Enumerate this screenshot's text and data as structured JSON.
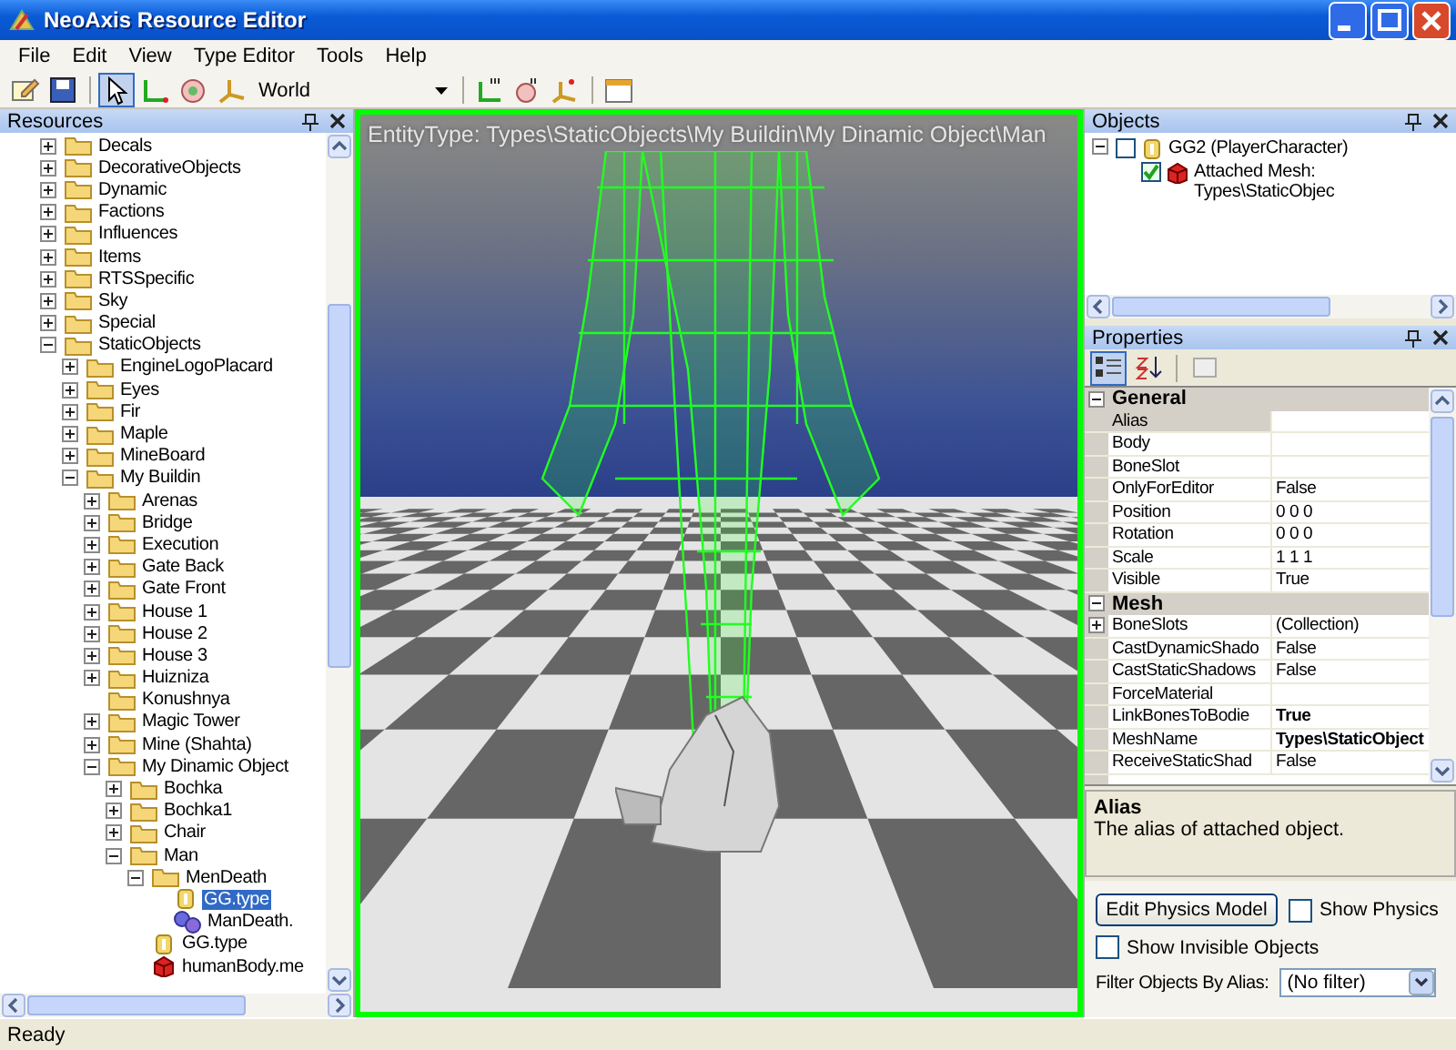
{
  "window": {
    "title": "NeoAxis Resource Editor"
  },
  "menu": [
    "File",
    "Edit",
    "View",
    "Type Editor",
    "Tools",
    "Help"
  ],
  "toolbar": {
    "groups": [
      [
        {
          "kind": "new",
          "selected": false
        },
        {
          "kind": "save",
          "selected": false
        }
      ],
      [
        {
          "kind": "select",
          "selected": true
        },
        {
          "kind": "move",
          "selected": false
        },
        {
          "kind": "rotate",
          "selected": false
        },
        {
          "kind": "scale",
          "selected": false
        }
      ]
    ],
    "space": "World",
    "groups_after": [
      [
        {
          "kind": "snap-move",
          "selected": false
        },
        {
          "kind": "snap-rotate",
          "selected": false
        },
        {
          "kind": "snap-scale",
          "selected": false
        }
      ],
      [
        {
          "kind": "window",
          "selected": false
        }
      ]
    ]
  },
  "resources": {
    "title": "Resources",
    "tree": [
      {
        "label": "Decals",
        "kind": "folder",
        "expanded": false,
        "selected": false
      },
      {
        "label": "DecorativeObjects",
        "kind": "folder",
        "expanded": false,
        "selected": false
      },
      {
        "label": "Dynamic",
        "kind": "folder",
        "expanded": false,
        "selected": false
      },
      {
        "label": "Factions",
        "kind": "folder",
        "expanded": false,
        "selected": false
      },
      {
        "label": "Influences",
        "kind": "folder",
        "expanded": false,
        "selected": false
      },
      {
        "label": "Items",
        "kind": "folder",
        "expanded": false,
        "selected": false
      },
      {
        "label": "RTSSpecific",
        "kind": "folder",
        "expanded": false,
        "selected": false
      },
      {
        "label": "Sky",
        "kind": "folder",
        "expanded": false,
        "selected": false
      },
      {
        "label": "Special",
        "kind": "folder",
        "expanded": false,
        "selected": false
      },
      {
        "label": "StaticObjects",
        "kind": "folder",
        "expanded": true,
        "selected": false,
        "children": [
          {
            "label": "EngineLogoPlacard",
            "kind": "folder",
            "expanded": false,
            "selected": false
          },
          {
            "label": "Eyes",
            "kind": "folder",
            "expanded": false,
            "selected": false
          },
          {
            "label": "Fir",
            "kind": "folder",
            "expanded": false,
            "selected": false
          },
          {
            "label": "Maple",
            "kind": "folder",
            "expanded": false,
            "selected": false
          },
          {
            "label": "MineBoard",
            "kind": "folder",
            "expanded": false,
            "selected": false
          },
          {
            "label": "My Buildin",
            "kind": "folder",
            "expanded": true,
            "selected": false,
            "children": [
              {
                "label": "Arenas",
                "kind": "folder",
                "expanded": false,
                "selected": false
              },
              {
                "label": "Bridge",
                "kind": "folder",
                "expanded": false,
                "selected": false
              },
              {
                "label": "Execution",
                "kind": "folder",
                "expanded": false,
                "selected": false
              },
              {
                "label": "Gate Back",
                "kind": "folder",
                "expanded": false,
                "selected": false
              },
              {
                "label": "Gate Front",
                "kind": "folder",
                "expanded": false,
                "selected": false
              },
              {
                "label": "House 1",
                "kind": "folder",
                "expanded": false,
                "selected": false
              },
              {
                "label": "House 2",
                "kind": "folder",
                "expanded": false,
                "selected": false
              },
              {
                "label": "House 3",
                "kind": "folder",
                "expanded": false,
                "selected": false
              },
              {
                "label": "Huizniza",
                "kind": "folder",
                "expanded": false,
                "selected": false
              },
              {
                "label": "Konushnya",
                "kind": "folder",
                "selected": false
              },
              {
                "label": "Magic Tower",
                "kind": "folder",
                "expanded": false,
                "selected": false
              },
              {
                "label": "Mine (Shahta)",
                "kind": "folder",
                "expanded": false,
                "selected": false
              },
              {
                "label": "My Dinamic Object",
                "kind": "folder",
                "expanded": true,
                "selected": false,
                "children": [
                  {
                    "label": "Bochka",
                    "kind": "folder",
                    "expanded": false,
                    "selected": false
                  },
                  {
                    "label": "Bochka1",
                    "kind": "folder",
                    "expanded": false,
                    "selected": false
                  },
                  {
                    "label": "Chair",
                    "kind": "folder",
                    "expanded": false,
                    "selected": false
                  },
                  {
                    "label": "Man",
                    "kind": "folder",
                    "expanded": true,
                    "selected": false,
                    "children": [
                      {
                        "label": "MenDeath",
                        "kind": "folder",
                        "expanded": true,
                        "selected": false,
                        "children": [
                          {
                            "label": "GG.type",
                            "kind": "type",
                            "selected": true
                          },
                          {
                            "label": "ManDeath.",
                            "kind": "gears",
                            "selected": false
                          }
                        ]
                      },
                      {
                        "label": "GG.type",
                        "kind": "type",
                        "selected": false
                      },
                      {
                        "label": "humanBody.me",
                        "kind": "mesh",
                        "selected": false
                      }
                    ]
                  }
                ]
              }
            ]
          }
        ]
      }
    ]
  },
  "viewport": {
    "caption": "EntityType: Types\\StaticObjects\\My Buildin\\My Dinamic Object\\Man"
  },
  "objects": {
    "title": "Objects",
    "tree": [
      {
        "label": "GG2 (PlayerCharacter)",
        "kind": "type",
        "checked": false,
        "expanded": true,
        "children": [
          {
            "label": "Attached Mesh: Types\\StaticObjec",
            "kind": "mesh",
            "checked": true
          }
        ]
      }
    ]
  },
  "properties": {
    "title": "Properties",
    "categories": [
      {
        "name": "General",
        "expanded": true,
        "rows": [
          {
            "name": "Alias",
            "selected": true,
            "kind": "plain"
          },
          {
            "name": "Body",
            "selected": false,
            "kind": "plain"
          },
          {
            "name": "BoneSlot",
            "selected": false,
            "kind": "plain"
          },
          {
            "name": "OnlyForEditor",
            "value": "False",
            "selected": false,
            "modified": false,
            "kind": "plain"
          },
          {
            "name": "Position",
            "value": "0 0 0",
            "selected": false,
            "modified": false,
            "kind": "plain"
          },
          {
            "name": "Rotation",
            "value": "0 0 0",
            "selected": false,
            "modified": false,
            "kind": "plain"
          },
          {
            "name": "Scale",
            "value": "1 1 1",
            "selected": false,
            "modified": false,
            "kind": "plain"
          },
          {
            "name": "Visible",
            "value": "True",
            "selected": false,
            "modified": false,
            "kind": "plain"
          }
        ]
      },
      {
        "name": "Mesh",
        "expanded": true,
        "rows": [
          {
            "name": "BoneSlots",
            "value": "(Collection)",
            "selected": false,
            "modified": false,
            "kind": "collection"
          },
          {
            "name": "CastDynamicShado",
            "value": "False",
            "selected": false,
            "modified": false,
            "kind": "plain"
          },
          {
            "name": "CastStaticShadows",
            "value": "False",
            "selected": false,
            "modified": false,
            "kind": "plain"
          },
          {
            "name": "ForceMaterial",
            "selected": false,
            "kind": "plain"
          },
          {
            "name": "LinkBonesToBodie",
            "value": "True",
            "selected": false,
            "modified": true,
            "kind": "plain"
          },
          {
            "name": "MeshName",
            "value": "Types\\StaticObject",
            "selected": false,
            "modified": true,
            "kind": "plain"
          },
          {
            "name": "ReceiveStaticShad",
            "value": "False",
            "selected": false,
            "modified": false,
            "kind": "plain"
          }
        ]
      }
    ],
    "description": {
      "title": "Alias",
      "text": "The alias of attached object."
    }
  },
  "physics": {
    "button": "Edit Physics Model",
    "show_physics": {
      "label": "Show Physics",
      "checked": false
    },
    "show_invisible": {
      "label": "Show Invisible Objects",
      "checked": false
    },
    "filter_label": "Filter Objects By Alias:",
    "filter_value": "(No filter)"
  },
  "status_bar": "Ready"
}
